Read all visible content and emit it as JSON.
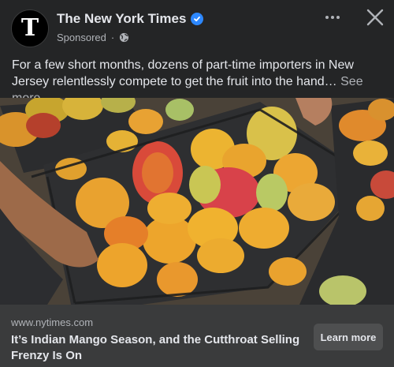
{
  "post": {
    "page_name": "The New York Times",
    "avatar_letter": "T",
    "sponsored_label": "Sponsored",
    "caption_text": "For a few short months, dozens of part-time importers in New Jersey relentlessly compete to get the fruit into the hand…",
    "see_more_label": "See more",
    "image_alt": "Baskets of mangoes in plastic crates being handled"
  },
  "link_preview": {
    "domain": "www.nytimes.com",
    "headline": "It’s Indian Mango Season, and the Cutthroat Selling Frenzy Is On",
    "cta_label": "Learn more"
  },
  "icons": {
    "verified": "verified-badge-icon",
    "privacy": "globe-icon",
    "more": "more-options-icon",
    "close": "close-icon"
  },
  "colors": {
    "background": "#242526",
    "footer": "#3a3b3c",
    "verified": "#2d88ff"
  }
}
